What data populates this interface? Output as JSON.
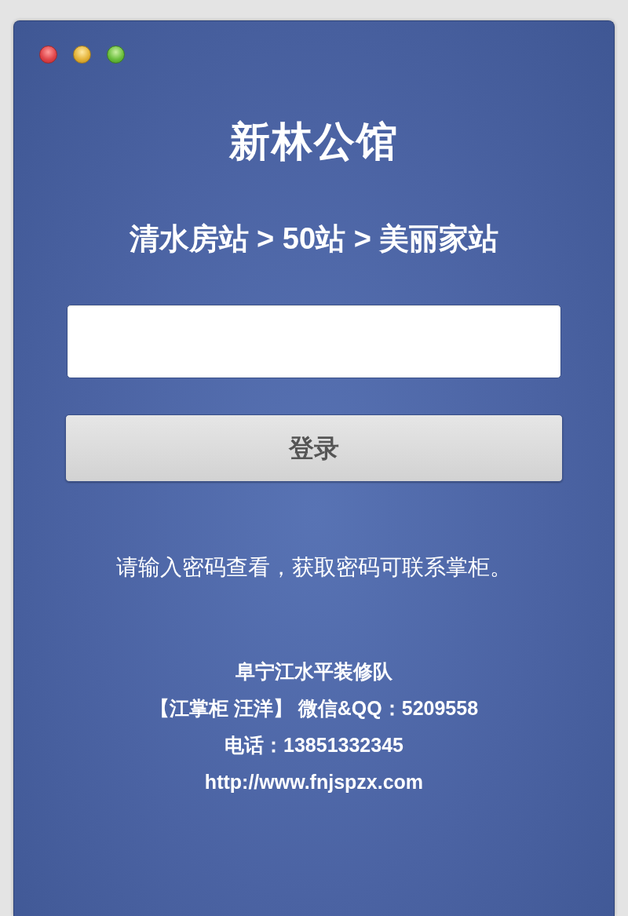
{
  "window": {
    "controls": [
      {
        "kind": "close"
      },
      {
        "kind": "minimize"
      },
      {
        "kind": "zoom"
      }
    ]
  },
  "title": "新林公馆",
  "breadcrumb": "清水房站 > 50站 > 美丽家站",
  "login_button": "登录",
  "hint": "请输入密码查看，获取密码可联系掌柜。",
  "contact": [
    "阜宁江水平装修队",
    "【江掌柜 汪洋】 微信&QQ：5209558",
    "电话：13851332345",
    "http://www.fnjspzx.com"
  ]
}
